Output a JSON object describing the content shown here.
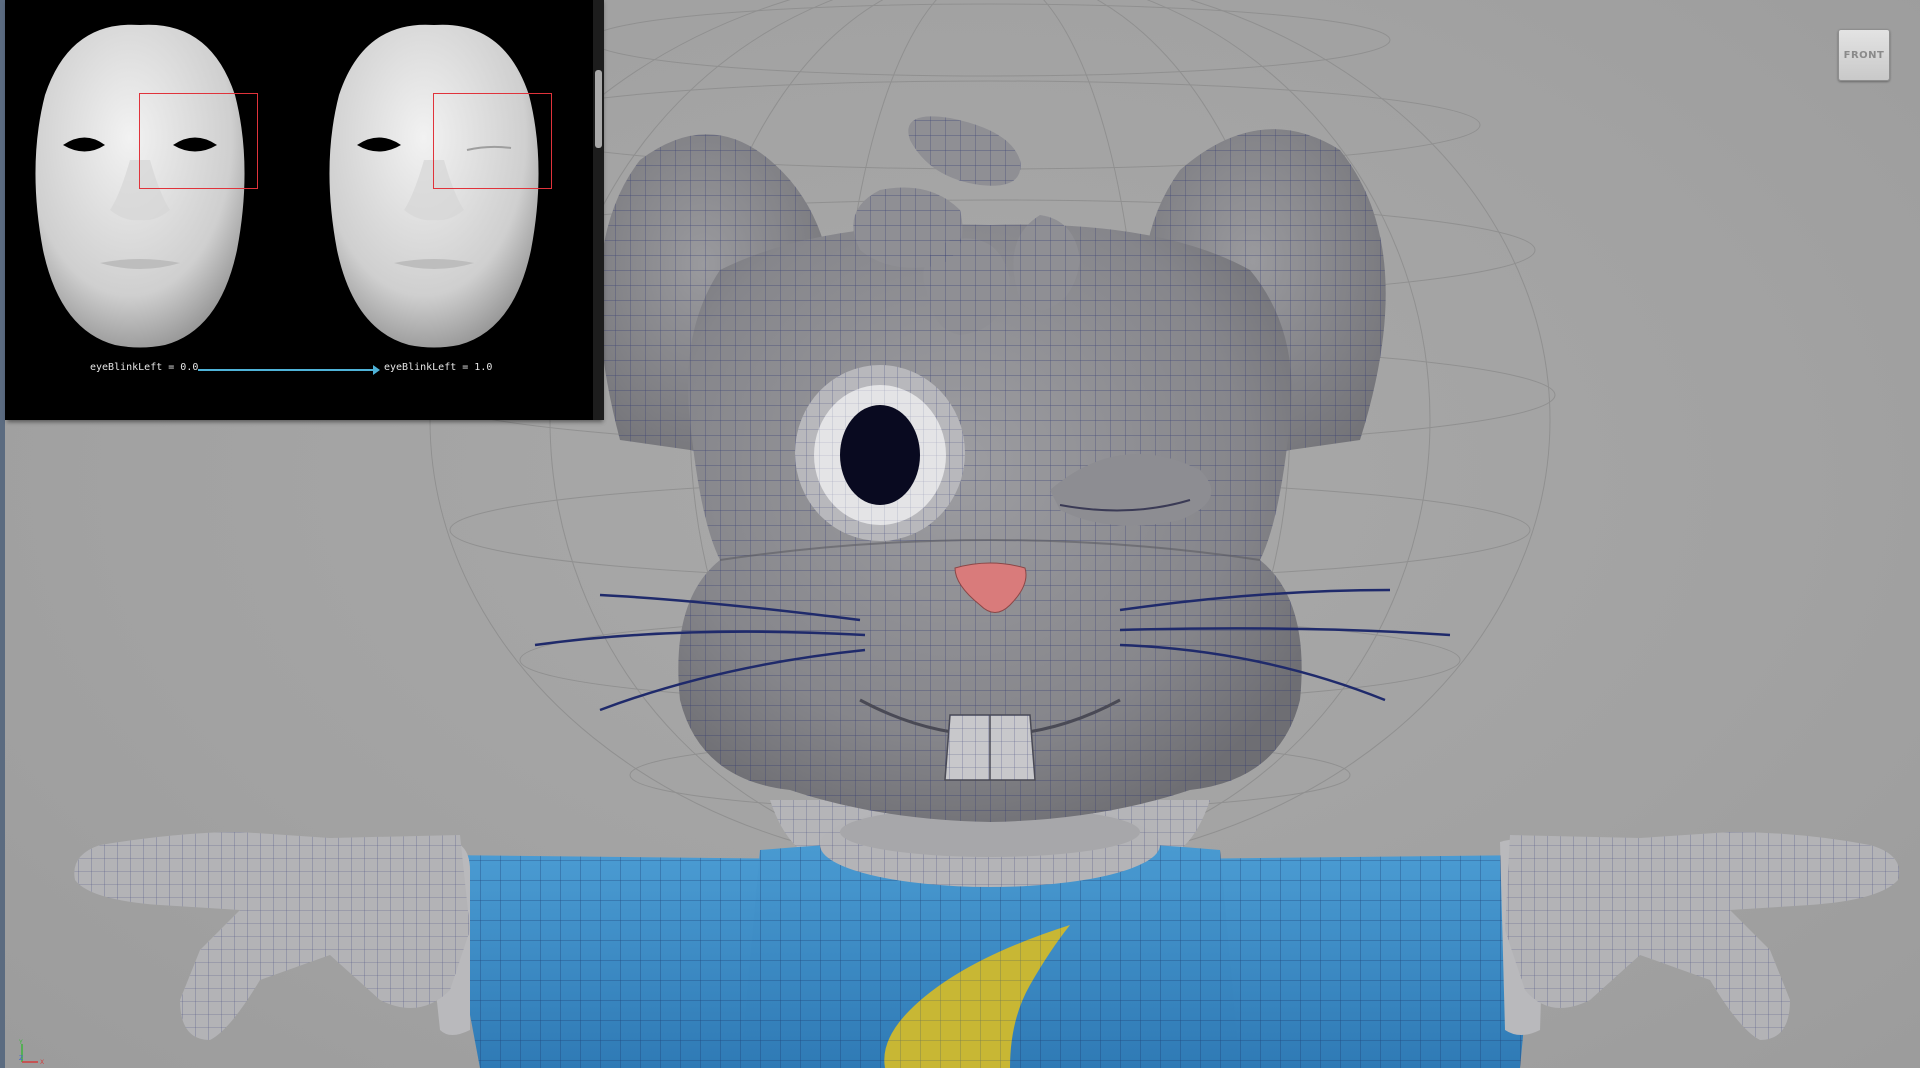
{
  "viewport": {
    "camera_label": "FRONT"
  },
  "reference_panel": {
    "before_caption": "eyeBlinkLeft = 0.0",
    "after_caption": "eyeBlinkLeft = 1.0",
    "arrow_color": "#4fb3d8",
    "highlight_color": "#e0333b"
  },
  "character": {
    "body_color": "#8e8e92",
    "shirt_color": "#3b8fc7",
    "emblem_color": "#c8b734",
    "nose_color": "#d97b7b",
    "wire_color": "#1f2a6b"
  },
  "axis_gizmo": {
    "y_label": "Y",
    "z_label": "Z",
    "x_label": "X"
  }
}
